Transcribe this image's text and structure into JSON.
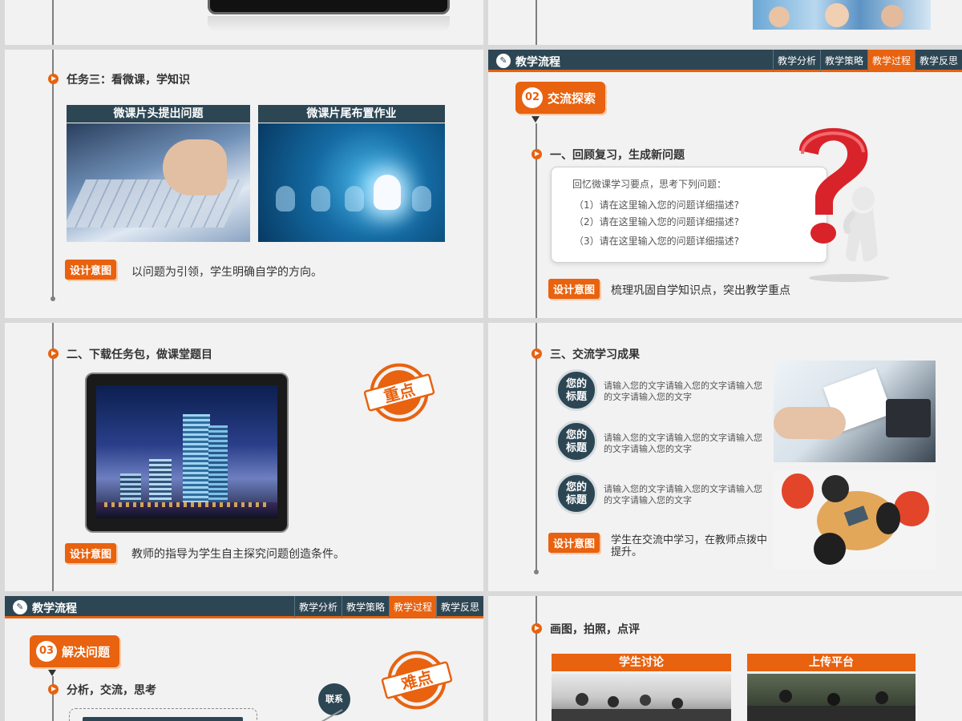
{
  "slide_top_right": {},
  "slide_task3": {
    "heading": "任务三：看微课，学知识",
    "caption_left": "微课片头提出问题",
    "caption_right": "微课片尾布置作业",
    "design_tag": "设计意图",
    "design_text": "以问题为引领，学生明确自学的方向。"
  },
  "slide_exchange": {
    "header": {
      "title": "教学流程",
      "tabs": [
        "教学分析",
        "教学策略",
        "教学过程",
        "教学反思"
      ],
      "active_tab": 2
    },
    "section_num": "02",
    "section_label": "交流探索",
    "heading": "一、回顾复习，生成新问题",
    "box_intro": "回忆微课学习要点，思考下列问题：",
    "questions": [
      "（1）请在这里输入您的问题详细描述?",
      "（2）请在这里输入您的问题详细描述?",
      "（3）请在这里输入您的问题详细描述?"
    ],
    "design_tag": "设计意图",
    "design_text": "梳理巩固自学知识点，突出教学重点"
  },
  "slide_download": {
    "heading": "二、下载任务包，做课堂题目",
    "stamp_text": "重点",
    "design_tag": "设计意图",
    "design_text": "教师的指导为学生自主探究问题创造条件。"
  },
  "slide_results": {
    "heading": "三、交流学习成果",
    "items": [
      {
        "title_line1": "您的",
        "title_line2": "标题",
        "text": "请输入您的文字请输入您的文字请输入您的文字请输入您的文字"
      },
      {
        "title_line1": "您的",
        "title_line2": "标题",
        "text": "请输入您的文字请输入您的文字请输入您的文字请输入您的文字"
      },
      {
        "title_line1": "您的",
        "title_line2": "标题",
        "text": "请输入您的文字请输入您的文字请输入您的文字请输入您的文字"
      }
    ],
    "design_tag": "设计意图",
    "design_text": "学生在交流中学习，在教师点拨中提升。"
  },
  "slide_solve": {
    "header": {
      "title": "教学流程",
      "tabs": [
        "教学分析",
        "教学策略",
        "教学过程",
        "教学反思"
      ],
      "active_tab": 2
    },
    "section_num": "03",
    "section_label": "解决问题",
    "heading": "分析，交流，思考",
    "stamp_text": "难点",
    "node_label": "联系"
  },
  "slide_draw": {
    "heading": "画图，拍照，点评",
    "caption_left": "学生讨论",
    "caption_right": "上传平台"
  },
  "colors": {
    "accent": "#e8620f",
    "navy": "#2d4654",
    "background": "#f2f2f2"
  }
}
